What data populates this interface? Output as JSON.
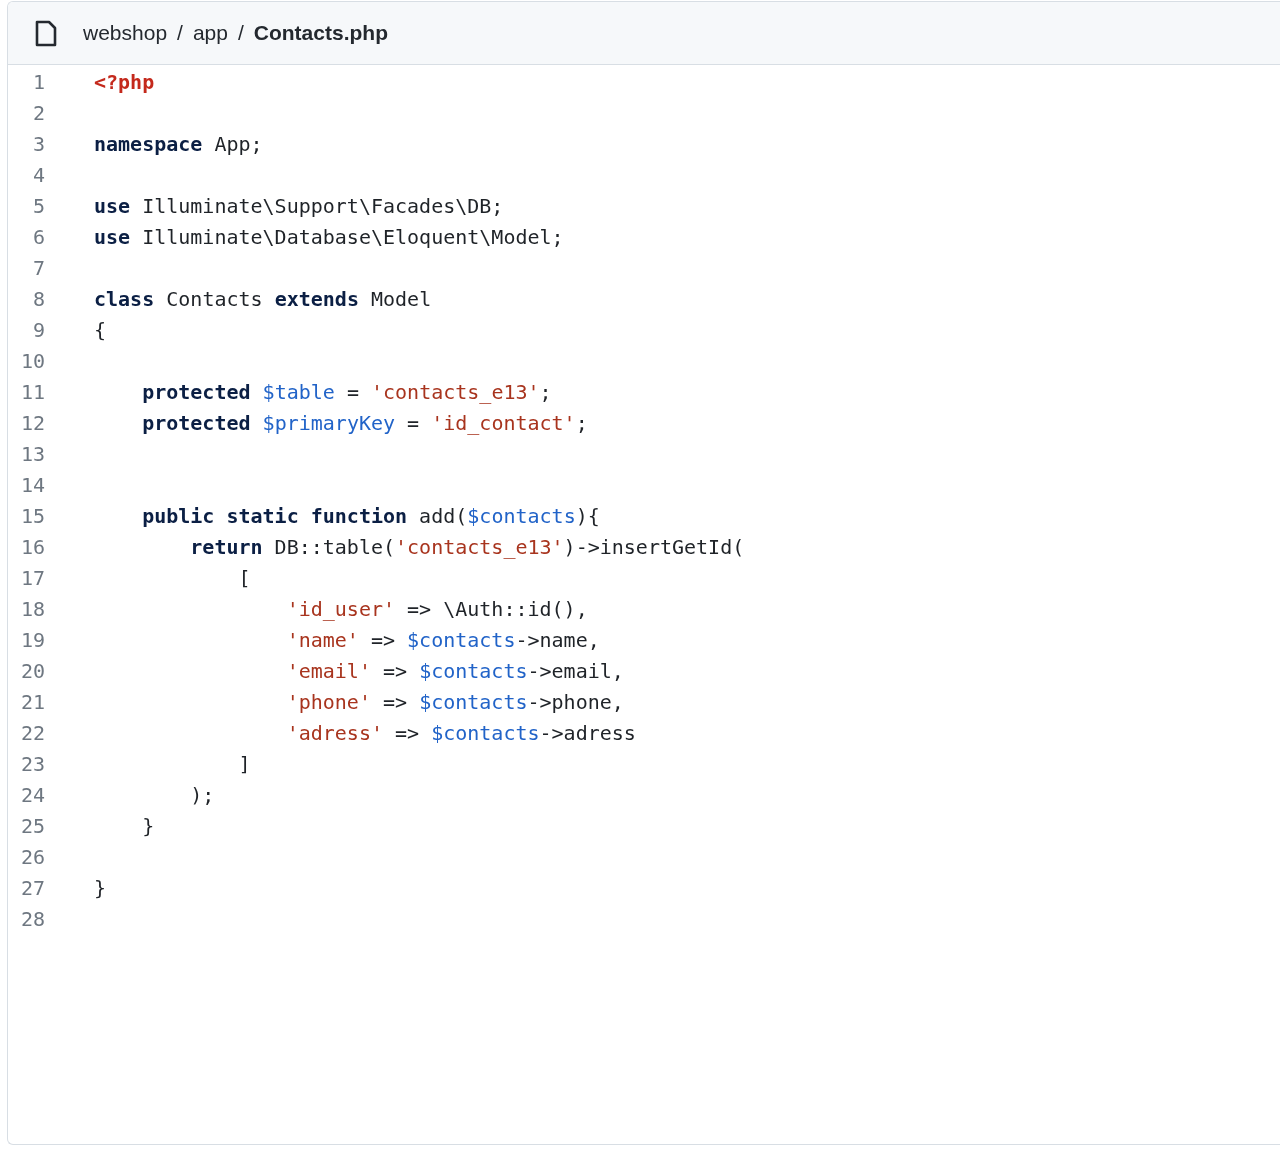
{
  "breadcrumb": {
    "separator": "/",
    "items": [
      {
        "text": "webshop",
        "current": false
      },
      {
        "text": "app",
        "current": false
      },
      {
        "text": "Contacts.php",
        "current": true
      }
    ]
  },
  "code": {
    "lines": [
      {
        "number": "1",
        "tokens": [
          {
            "kind": "tag",
            "text": "<?php"
          }
        ]
      },
      {
        "number": "2"
      },
      {
        "number": "3",
        "tokens": [
          {
            "kind": "keyword",
            "text": "namespace"
          },
          {
            "kind": "plain",
            "text": " App;"
          }
        ]
      },
      {
        "number": "4"
      },
      {
        "number": "5",
        "tokens": [
          {
            "kind": "keyword",
            "text": "use"
          },
          {
            "kind": "plain",
            "text": " Illuminate\\Support\\Facades\\DB;"
          }
        ]
      },
      {
        "number": "6",
        "tokens": [
          {
            "kind": "keyword",
            "text": "use"
          },
          {
            "kind": "plain",
            "text": " Illuminate\\Database\\Eloquent\\Model;"
          }
        ]
      },
      {
        "number": "7"
      },
      {
        "number": "8",
        "tokens": [
          {
            "kind": "keyword",
            "text": "class"
          },
          {
            "kind": "plain",
            "text": " Contacts "
          },
          {
            "kind": "keyword",
            "text": "extends"
          },
          {
            "kind": "plain",
            "text": " Model"
          }
        ]
      },
      {
        "number": "9",
        "tokens": [
          {
            "kind": "plain",
            "text": "{"
          }
        ]
      },
      {
        "number": "10"
      },
      {
        "number": "11",
        "tokens": [
          {
            "kind": "keyword",
            "text": "    protected"
          },
          {
            "kind": "variable",
            "text": " $table"
          },
          {
            "kind": "plain",
            "text": " = "
          },
          {
            "kind": "string",
            "text": "'contacts_e13'"
          },
          {
            "kind": "plain",
            "text": ";"
          }
        ]
      },
      {
        "number": "12",
        "tokens": [
          {
            "kind": "keyword",
            "text": "    protected"
          },
          {
            "kind": "variable",
            "text": " $primaryKey"
          },
          {
            "kind": "plain",
            "text": " = "
          },
          {
            "kind": "string",
            "text": "'id_contact'"
          },
          {
            "kind": "plain",
            "text": ";"
          }
        ]
      },
      {
        "number": "13"
      },
      {
        "number": "14"
      },
      {
        "number": "15",
        "tokens": [
          {
            "kind": "keyword",
            "text": "    public static function"
          },
          {
            "kind": "plain",
            "text": " add("
          },
          {
            "kind": "variable",
            "text": "$contacts"
          },
          {
            "kind": "plain",
            "text": "){"
          }
        ]
      },
      {
        "number": "16",
        "tokens": [
          {
            "kind": "keyword",
            "text": "        return"
          },
          {
            "kind": "plain",
            "text": " DB::table("
          },
          {
            "kind": "string",
            "text": "'contacts_e13'"
          },
          {
            "kind": "plain",
            "text": ")->insertGetId("
          }
        ]
      },
      {
        "number": "17",
        "tokens": [
          {
            "kind": "plain",
            "text": "            ["
          }
        ]
      },
      {
        "number": "18",
        "tokens": [
          {
            "kind": "string",
            "text": "                'id_user'"
          },
          {
            "kind": "plain",
            "text": " => \\Auth::id(),"
          }
        ]
      },
      {
        "number": "19",
        "tokens": [
          {
            "kind": "string",
            "text": "                'name'"
          },
          {
            "kind": "plain",
            "text": " => "
          },
          {
            "kind": "variable",
            "text": "$contacts"
          },
          {
            "kind": "plain",
            "text": "->name,"
          }
        ]
      },
      {
        "number": "20",
        "tokens": [
          {
            "kind": "string",
            "text": "                'email'"
          },
          {
            "kind": "plain",
            "text": " => "
          },
          {
            "kind": "variable",
            "text": "$contacts"
          },
          {
            "kind": "plain",
            "text": "->email,"
          }
        ]
      },
      {
        "number": "21",
        "tokens": [
          {
            "kind": "string",
            "text": "                'phone'"
          },
          {
            "kind": "plain",
            "text": " => "
          },
          {
            "kind": "variable",
            "text": "$contacts"
          },
          {
            "kind": "plain",
            "text": "->phone,"
          }
        ]
      },
      {
        "number": "22",
        "tokens": [
          {
            "kind": "string",
            "text": "                'adress'"
          },
          {
            "kind": "plain",
            "text": " => "
          },
          {
            "kind": "variable",
            "text": "$contacts"
          },
          {
            "kind": "plain",
            "text": "->adress"
          }
        ]
      },
      {
        "number": "23",
        "tokens": [
          {
            "kind": "plain",
            "text": "            ]"
          }
        ]
      },
      {
        "number": "24",
        "tokens": [
          {
            "kind": "plain",
            "text": "        );"
          }
        ]
      },
      {
        "number": "25",
        "tokens": [
          {
            "kind": "plain",
            "text": "    }"
          }
        ]
      },
      {
        "number": "26"
      },
      {
        "number": "27",
        "tokens": [
          {
            "kind": "plain",
            "text": "}"
          }
        ]
      },
      {
        "number": "28"
      }
    ]
  }
}
